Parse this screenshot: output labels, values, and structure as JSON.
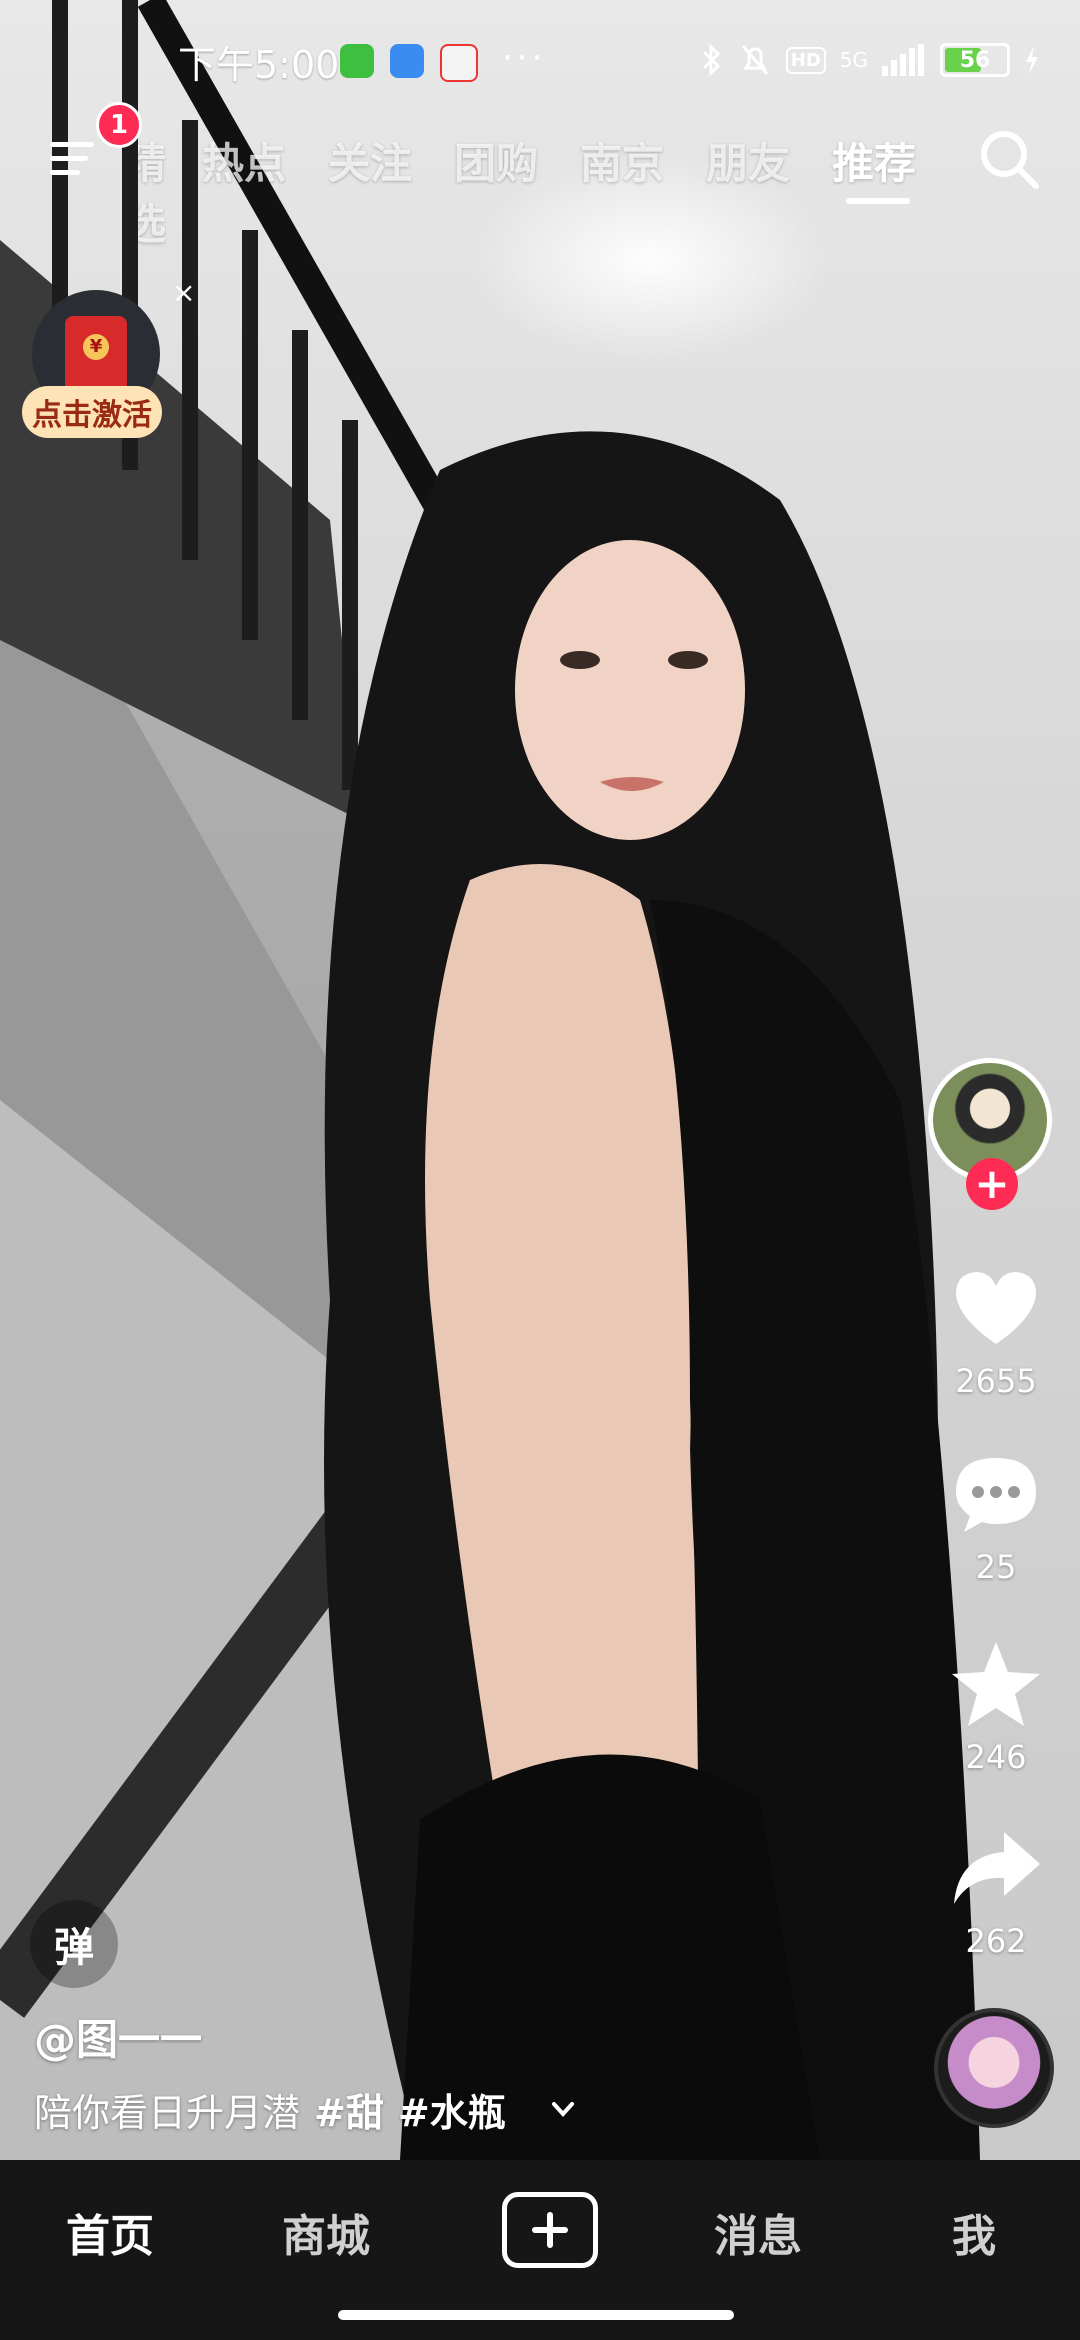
{
  "status_bar": {
    "time": "下午5:00",
    "battery_level": "56",
    "network": "5G"
  },
  "top_nav": {
    "menu_badge": "1",
    "partial_tab": "精选",
    "tabs": [
      "热点",
      "关注",
      "团购",
      "南京",
      "朋友",
      "推荐"
    ],
    "active_tab": "推荐"
  },
  "red_packet": {
    "label": "点击激活",
    "close": "×"
  },
  "actions": {
    "likes": "2655",
    "comments": "25",
    "favorites": "246",
    "shares": "262"
  },
  "video_info": {
    "danmu_label": "弹",
    "author": "@图一一",
    "caption_text": "陪你看日升月潜",
    "hashtags": [
      "#甜",
      "#水瓶"
    ]
  },
  "bottom_nav": {
    "items": [
      "首页",
      "商城",
      "消息",
      "我"
    ]
  },
  "colors": {
    "accent": "#fe2c55",
    "nav_bg": "#161616",
    "battery_fill": "#6ad14a"
  }
}
